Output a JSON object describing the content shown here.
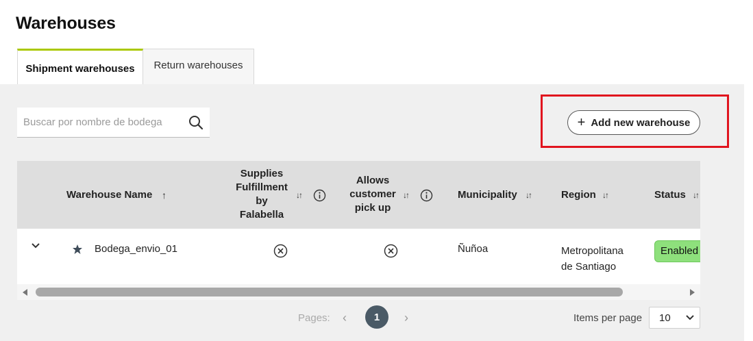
{
  "page": {
    "title": "Warehouses"
  },
  "tabs": [
    {
      "label": "Shipment warehouses",
      "active": true
    },
    {
      "label": "Return warehouses",
      "active": false
    }
  ],
  "search": {
    "placeholder": "Buscar por nombre de bodega",
    "value": "",
    "icon": "search-icon"
  },
  "actions": {
    "add_label": "Add new warehouse",
    "add_icon": "plus-icon"
  },
  "table": {
    "headers": {
      "name": "Warehouse Name",
      "fulfillment_line1": "Supplies",
      "fulfillment_line2": "Fulfillment",
      "fulfillment_line3": "by",
      "fulfillment_line4": "Falabella",
      "pickup_line1": "Allows",
      "pickup_line2": "customer",
      "pickup_line3": "pick up",
      "municipality": "Municipality",
      "region": "Region",
      "status": "Status"
    },
    "rows": [
      {
        "name": "Bodega_envio_01",
        "starred": true,
        "fulfillment": "no",
        "pickup": "no",
        "municipality": "Ñuñoa",
        "region_line1": "Metropolitana",
        "region_line2": "de Santiago",
        "status": "Enabled"
      }
    ],
    "scroll_position": 0.0
  },
  "pagination": {
    "pages_label": "Pages:",
    "current_page": "1"
  },
  "items_per_page": {
    "label": "Items per page",
    "value": "10"
  },
  "colors": {
    "accent": "#aac800",
    "highlight": "#e1141e",
    "status_enabled": "#8ee07c",
    "page_active": "#4a5a66",
    "panel": "#f0f0f0",
    "header": "#dedede"
  }
}
